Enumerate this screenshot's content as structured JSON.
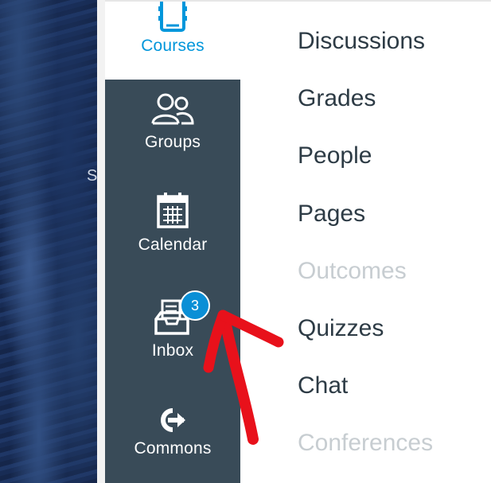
{
  "global_nav": {
    "items": [
      {
        "label": "Courses",
        "icon": "book-icon",
        "active": true
      },
      {
        "label": "Groups",
        "icon": "groups-icon",
        "active": false
      },
      {
        "label": "Calendar",
        "icon": "calendar-icon",
        "active": false
      },
      {
        "label": "Inbox",
        "icon": "inbox-icon",
        "active": false,
        "badge": "3"
      },
      {
        "label": "Commons",
        "icon": "commons-icon",
        "active": false
      }
    ]
  },
  "course_nav": {
    "links": [
      {
        "label": "Discussions",
        "enabled": true
      },
      {
        "label": "Grades",
        "enabled": true
      },
      {
        "label": "People",
        "enabled": true
      },
      {
        "label": "Pages",
        "enabled": true
      },
      {
        "label": "Outcomes",
        "enabled": false
      },
      {
        "label": "Quizzes",
        "enabled": true
      },
      {
        "label": "Chat",
        "enabled": true
      },
      {
        "label": "Conferences",
        "enabled": false
      }
    ]
  },
  "background": {
    "partial_text": "S"
  },
  "colors": {
    "nav_bg": "#394b58",
    "active_accent": "#0096db",
    "badge": "#0a8fd6",
    "link_text": "#2d3b45",
    "disabled_text": "#c7cdd1",
    "annotation_arrow": "#e8111b"
  }
}
